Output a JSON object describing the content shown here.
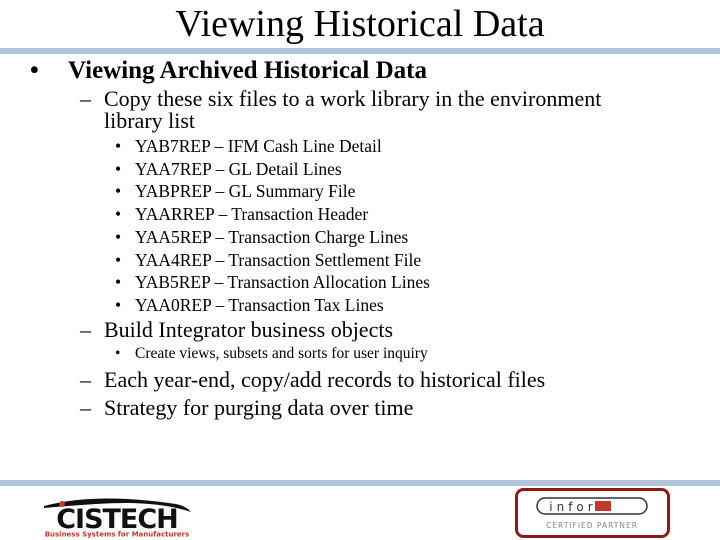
{
  "slide": {
    "title": "Viewing Historical Data",
    "main_bullet": "Viewing Archived Historical Data",
    "bullet_glyph": "•",
    "dash_glyph": "–",
    "copy_item": {
      "line1": "Copy these six files to a work library in the environment",
      "line2": "library list"
    },
    "files": [
      "YAB7REP – IFM Cash Line Detail",
      "YAA7REP – GL Detail Lines",
      "YABPREP – GL Summary File",
      "YAARREP – Transaction Header",
      "YAA5REP – Transaction Charge Lines",
      "YAA4REP – Transaction Settlement File",
      "YAB5REP – Transaction Allocation Lines",
      "YAA0REP – Transaction Tax Lines"
    ],
    "build_item": "Build Integrator business objects",
    "build_sub": "Create views, subsets and sorts for user inquiry",
    "yearend_item": "Each year-end, copy/add records to historical files",
    "strategy_item": "Strategy for purging data over time"
  },
  "footer": {
    "cistech_name": "CISTECH",
    "cistech_tagline": "Business Systems for Manufacturers",
    "infor_name": "infor",
    "infor_tagline": "CERTIFIED PARTNER"
  },
  "colors": {
    "rule": "#b3c5d8",
    "cistech_red": "#c0392b",
    "infor_border": "#8b1a1a"
  }
}
